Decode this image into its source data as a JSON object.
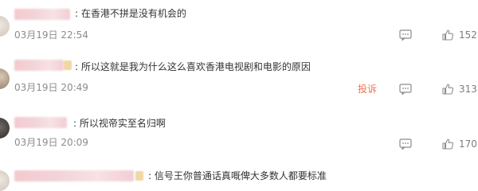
{
  "comments": [
    {
      "separator": ":",
      "text": "在香港不拼是没有机会的",
      "time": "03月19日 22:54",
      "likes": "152",
      "report": ""
    },
    {
      "separator": ":",
      "text": "所以这就是我为什么这么喜欢香港电视剧和电影的原因",
      "time": "03月19日 20:49",
      "likes": "313",
      "report": "投诉"
    },
    {
      "separator": ":",
      "text": "所以视帝实至名归啊",
      "time": "03月19日 20:09",
      "likes": "170",
      "report": ""
    },
    {
      "separator": ":",
      "text": "信号王你普通话真嘅俾大多数人都要标准",
      "time": "",
      "likes": "",
      "report": ""
    }
  ]
}
